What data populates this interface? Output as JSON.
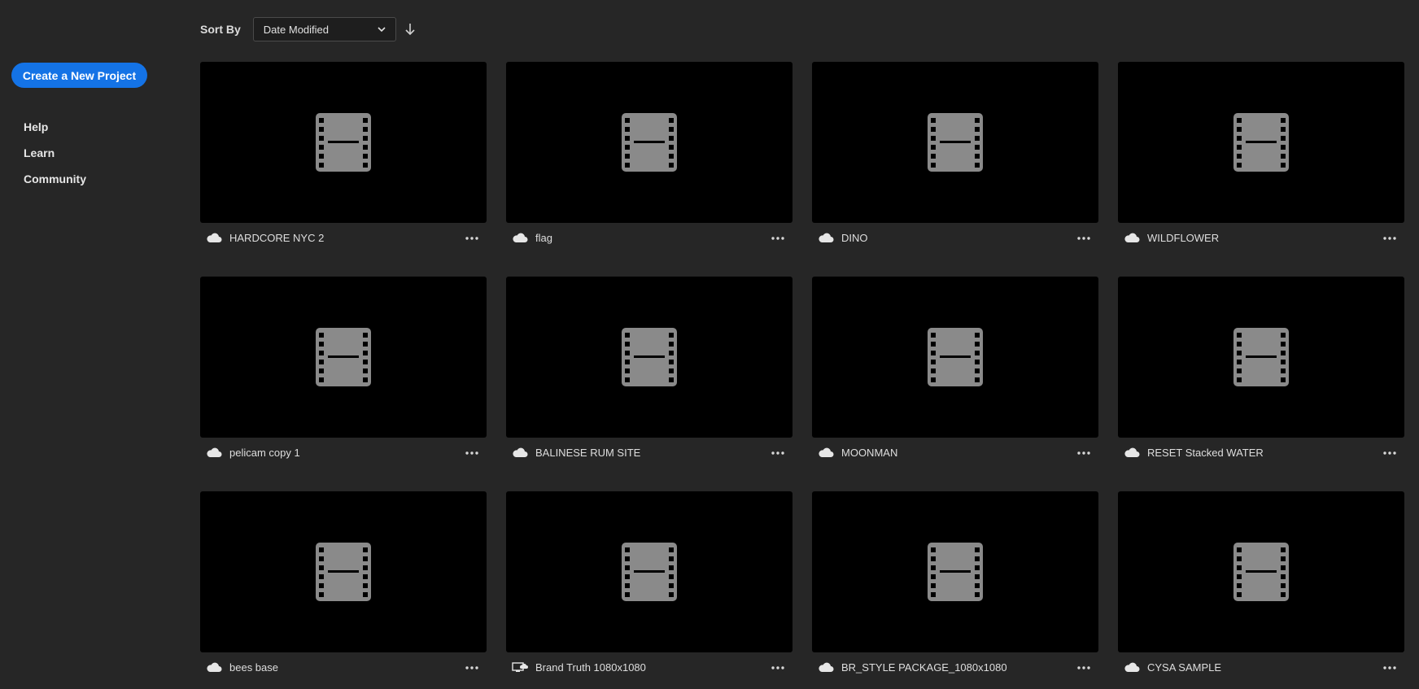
{
  "sidebar": {
    "create_label": "Create a New Project",
    "nav": [
      {
        "label": "Help"
      },
      {
        "label": "Learn"
      },
      {
        "label": "Community"
      }
    ]
  },
  "toolbar": {
    "sort_label": "Sort By",
    "sort_value": "Date Modified",
    "sort_direction_icon": "arrow-down-icon"
  },
  "colors": {
    "accent": "#1473e6",
    "background": "#262626",
    "thumbnail": "#000000",
    "film_icon": "#8a8a8a"
  },
  "projects": [
    {
      "name": "HARDCORE NYC 2",
      "storage": "cloud"
    },
    {
      "name": "flag",
      "storage": "cloud"
    },
    {
      "name": "DINO",
      "storage": "cloud"
    },
    {
      "name": "WILDFLOWER",
      "storage": "cloud"
    },
    {
      "name": "pelicam copy 1",
      "storage": "cloud"
    },
    {
      "name": "BALINESE RUM SITE",
      "storage": "cloud"
    },
    {
      "name": "MOONMAN",
      "storage": "cloud"
    },
    {
      "name": "RESET Stacked  WATER",
      "storage": "cloud"
    },
    {
      "name": "bees base",
      "storage": "cloud"
    },
    {
      "name": "Brand Truth 1080x1080",
      "storage": "local-sync"
    },
    {
      "name": "BR_STYLE PACKAGE_1080x1080",
      "storage": "cloud"
    },
    {
      "name": "CYSA SAMPLE",
      "storage": "cloud"
    }
  ]
}
